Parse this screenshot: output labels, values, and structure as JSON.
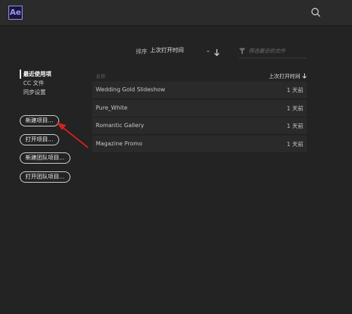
{
  "app": {
    "logo_text": "Ae",
    "accent": "#9999ff"
  },
  "toolbar": {
    "search_icon": "search-icon"
  },
  "sort": {
    "label": "排序",
    "value": "上次打开时间",
    "direction_icon": "arrow-down-icon"
  },
  "filter": {
    "placeholder": "筛选最近的文件",
    "icon": "funnel-icon"
  },
  "sidebar": {
    "items": [
      {
        "label": "最近使用项",
        "active": true
      },
      {
        "label": "CC 文件",
        "active": false
      },
      {
        "label": "同步设置",
        "active": false
      }
    ]
  },
  "actions": {
    "new_project": "新建项目...",
    "open_project": "打开项目...",
    "new_team_project": "新建团队项目...",
    "open_team_project": "打开团队项目..."
  },
  "list": {
    "headers": {
      "name": "名称",
      "date": "上次打开时间"
    },
    "rows": [
      {
        "name": "Wedding Gold Slideshow",
        "date": "1 天前"
      },
      {
        "name": "Pure_White",
        "date": "1 天前"
      },
      {
        "name": "Romantic Gallery",
        "date": "1 天前"
      },
      {
        "name": "Magazine Promo",
        "date": "1 天前"
      }
    ]
  },
  "annotation": {
    "color": "#d42020",
    "points_to": "new_project"
  }
}
